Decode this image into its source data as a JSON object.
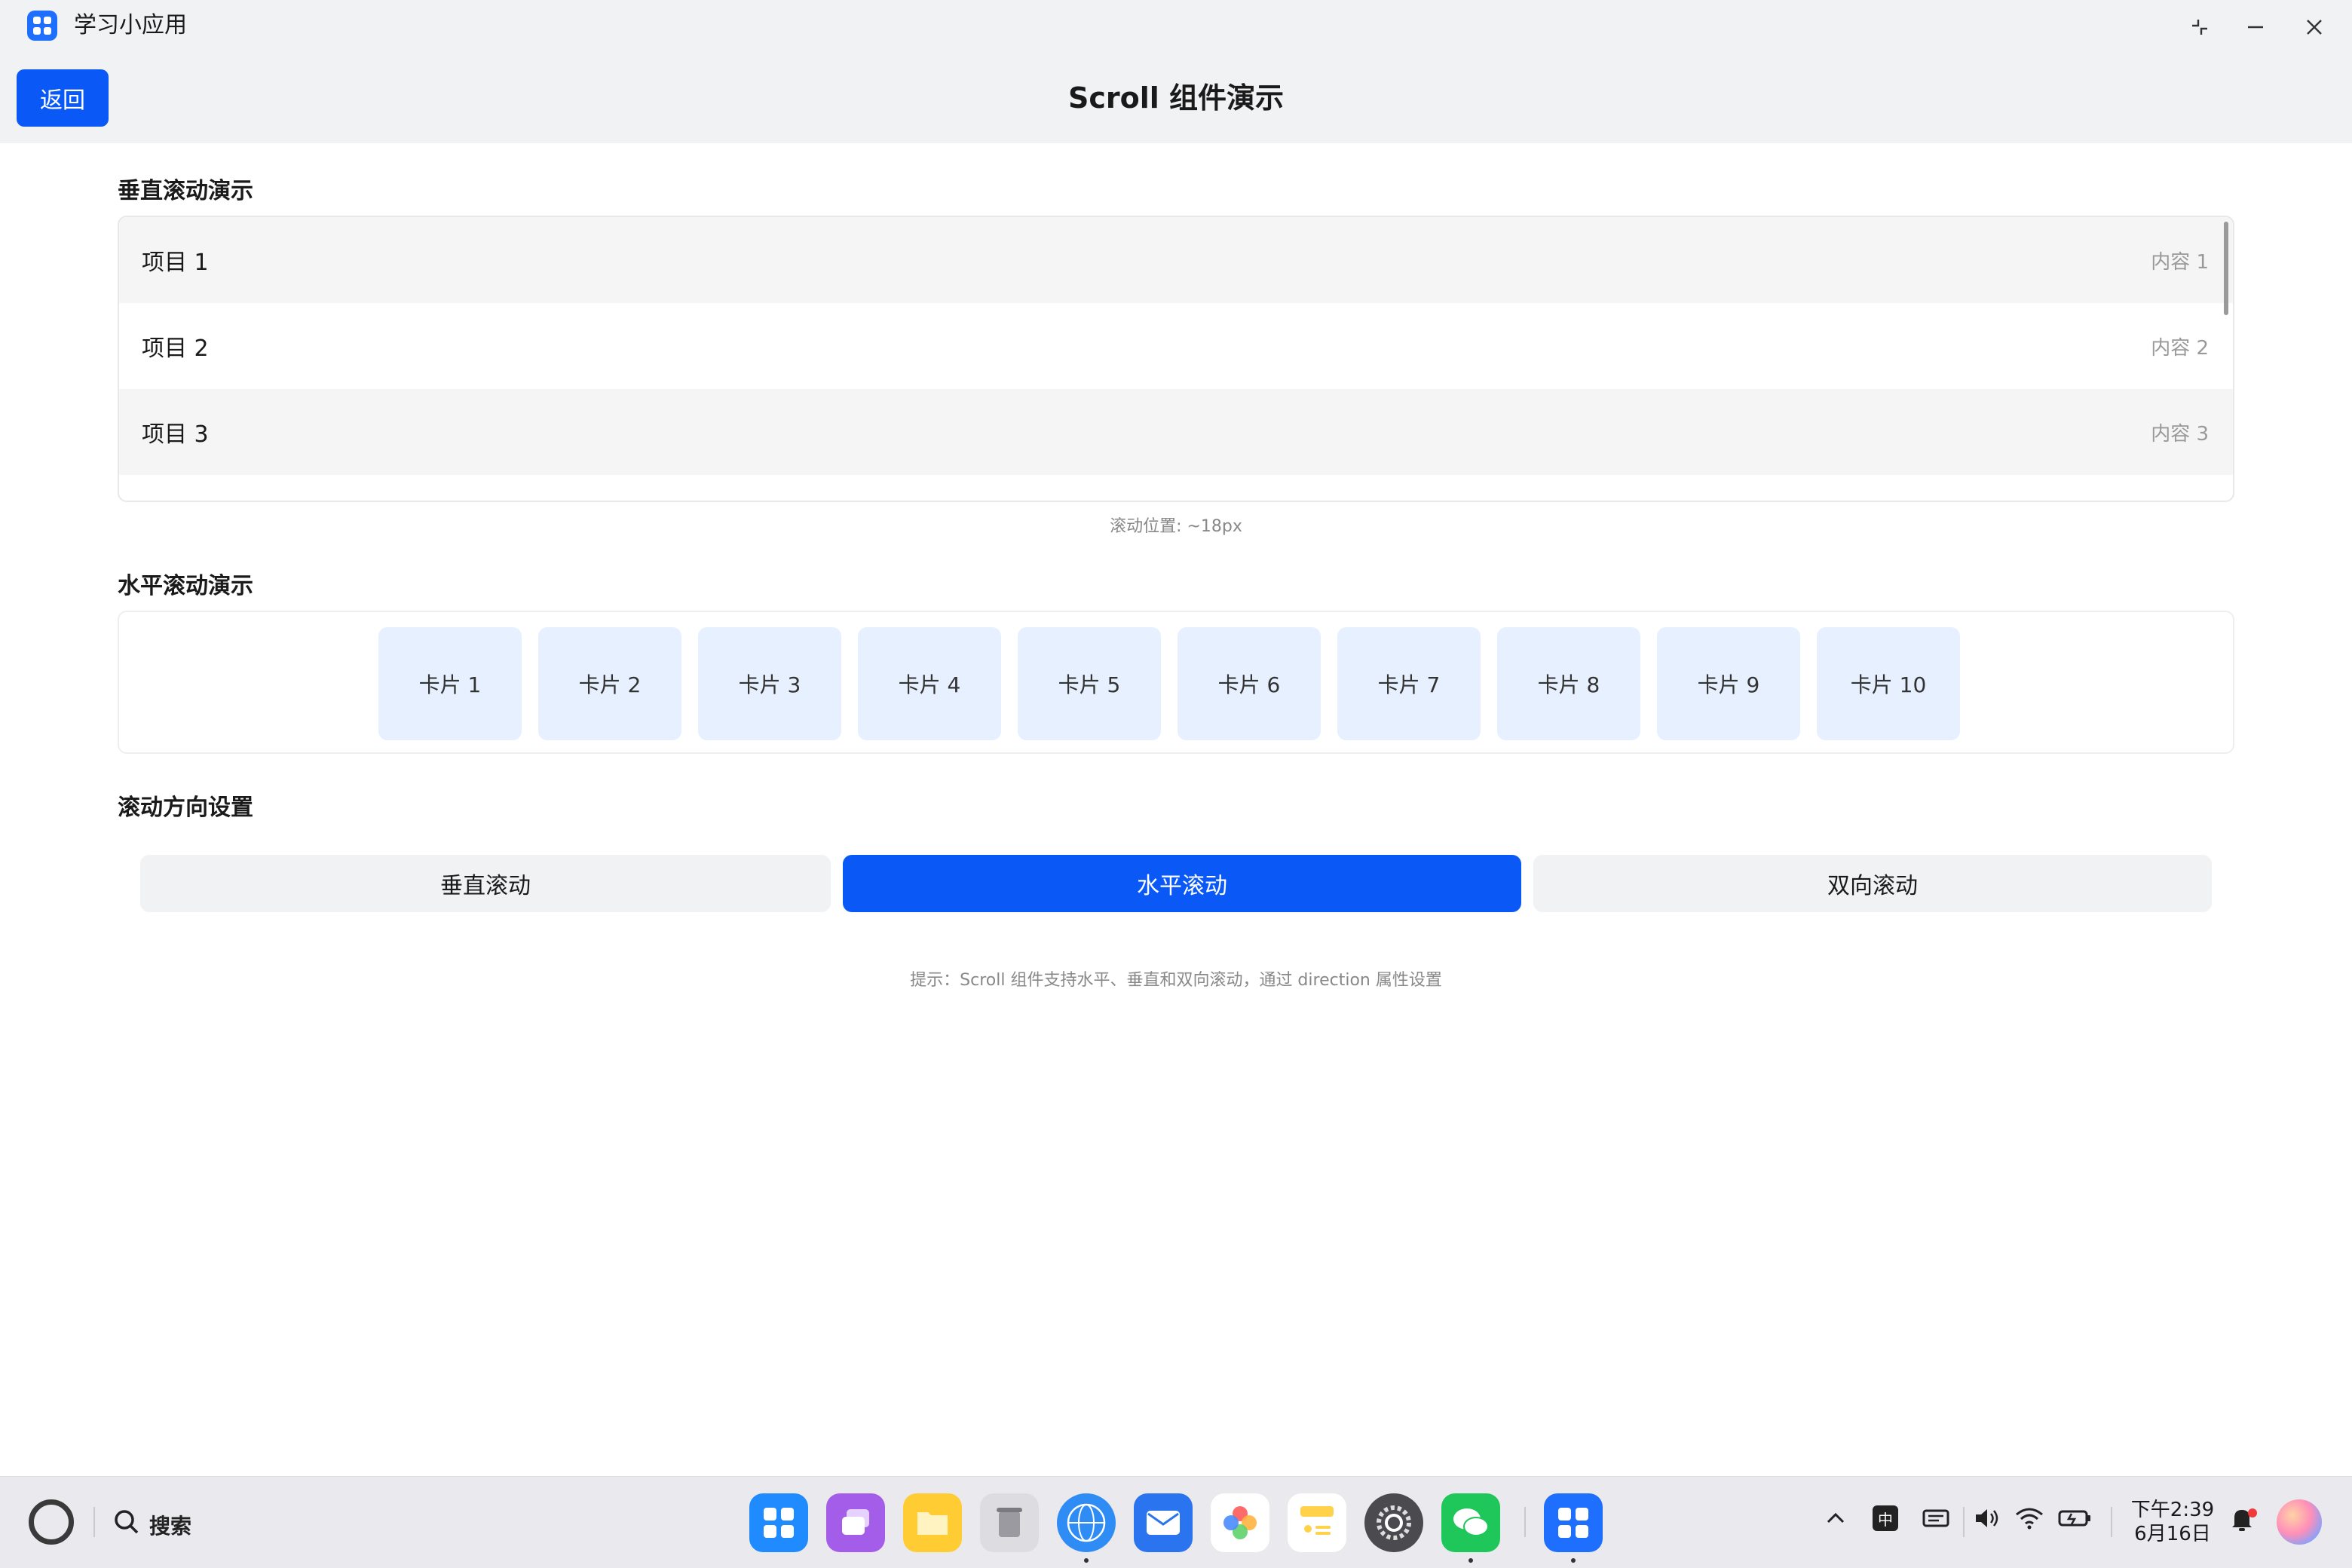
{
  "window": {
    "title": "学习小应用",
    "controls": {
      "restore_icon": "restore-icon",
      "minimize_icon": "minimize-icon",
      "close_icon": "close-icon"
    }
  },
  "header": {
    "back_label": "返回",
    "title": "Scroll 组件演示"
  },
  "vertical_section": {
    "title": "垂直滚动演示",
    "items": [
      {
        "label": "项目 1",
        "content": "内容 1"
      },
      {
        "label": "项目 2",
        "content": "内容 2"
      },
      {
        "label": "项目 3",
        "content": "内容 3"
      }
    ],
    "scroll_position": "滚动位置: ~18px"
  },
  "horizontal_section": {
    "title": "水平滚动演示",
    "cards": [
      "卡片 1",
      "卡片 2",
      "卡片 3",
      "卡片 4",
      "卡片 5",
      "卡片 6",
      "卡片 7",
      "卡片 8",
      "卡片 9",
      "卡片 10"
    ]
  },
  "direction_section": {
    "title": "滚动方向设置",
    "options": [
      {
        "label": "垂直滚动",
        "active": false
      },
      {
        "label": "水平滚动",
        "active": true
      },
      {
        "label": "双向滚动",
        "active": false
      }
    ]
  },
  "hint": "提示：Scroll 组件支持水平、垂直和双向滚动，通过 direction 属性设置",
  "taskbar": {
    "search_label": "搜索",
    "dock": [
      {
        "name": "app-grid-icon",
        "color": "#1f8bff"
      },
      {
        "name": "multitask-icon",
        "color": "#a45de8"
      },
      {
        "name": "files-icon",
        "color": "#ffcc33"
      },
      {
        "name": "trash-icon",
        "color": "#c9c9cf"
      },
      {
        "name": "browser-icon",
        "color": "#2f8cf5"
      },
      {
        "name": "mail-icon",
        "color": "#2a74f0"
      },
      {
        "name": "photos-icon",
        "color": "#ff8a3d"
      },
      {
        "name": "notes-icon",
        "color": "#ffd24a"
      },
      {
        "name": "settings-icon",
        "color": "#4a4a4f"
      },
      {
        "name": "wechat-icon",
        "color": "#1fc75a"
      },
      {
        "name": "study-app-icon",
        "color": "#1f6fff"
      }
    ],
    "ime_label": "中",
    "clock_time": "下午2:39",
    "clock_date": "6月16日",
    "accent": "#0a59f7"
  }
}
